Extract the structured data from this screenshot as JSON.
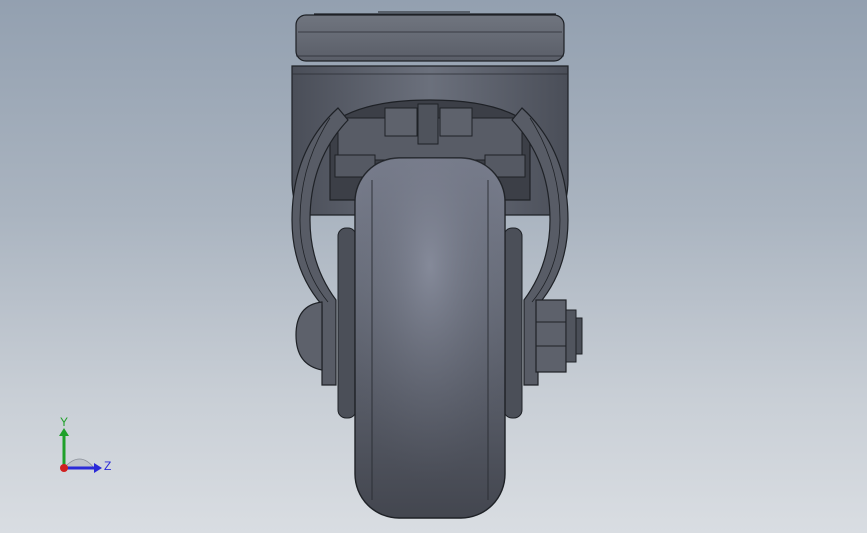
{
  "viewport": {
    "background_top": "#93a0b0",
    "background_bottom": "#d9dde2",
    "part_color": "#5f6470",
    "edge_color": "#1e2126"
  },
  "triad": {
    "y_label": "Y",
    "z_label": "Z",
    "y_color": "#1fa02a",
    "z_color": "#2a2ad8",
    "x_color": "#d02020"
  }
}
